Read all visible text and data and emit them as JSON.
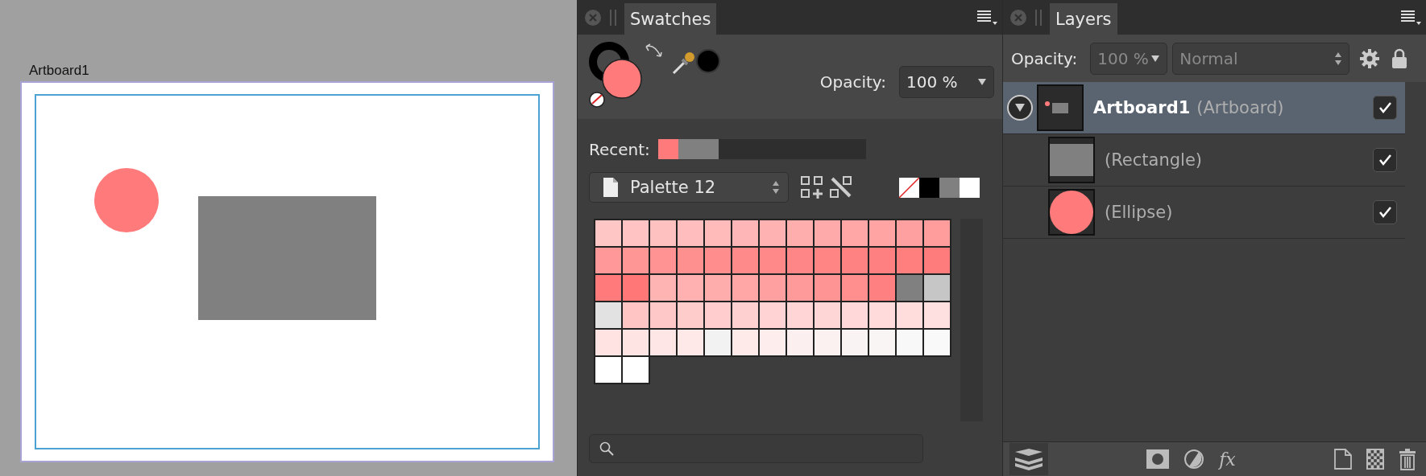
{
  "canvas": {
    "artboard_label": "Artboard1",
    "shapes": [
      {
        "kind": "ellipse",
        "color": "#ff7b7b"
      },
      {
        "kind": "rectangle",
        "color": "#808080"
      }
    ]
  },
  "swatches": {
    "tab": {
      "label": "Swatches",
      "selected": true
    },
    "fill": {
      "color": "#ff7b7b"
    },
    "stroke": {
      "color": "#000000"
    },
    "picked": {
      "color": "#000000"
    },
    "opacity": {
      "label": "Opacity:",
      "value": "100 %"
    },
    "recent": {
      "label": "Recent:",
      "colors": [
        {
          "color": "#ff7b7b"
        },
        {
          "color": "#808080"
        },
        {
          "color": "#808080"
        }
      ]
    },
    "palette": {
      "name": "Palette 12"
    },
    "quick": [
      {
        "kind": "none",
        "color": "#ffffff"
      },
      {
        "kind": "solid",
        "color": "#000000"
      },
      {
        "kind": "solid",
        "color": "#808080"
      },
      {
        "kind": "solid",
        "color": "#ffffff"
      }
    ],
    "grid": [
      {
        "color": "#ffc6c6"
      },
      {
        "color": "#ffc3c3"
      },
      {
        "color": "#ffc0c0"
      },
      {
        "color": "#ffbdbd"
      },
      {
        "color": "#ffbaba"
      },
      {
        "color": "#ffb6b6"
      },
      {
        "color": "#ffb2b2"
      },
      {
        "color": "#ffaeae"
      },
      {
        "color": "#ffaaaa"
      },
      {
        "color": "#ffa7a7"
      },
      {
        "color": "#ffa3a3"
      },
      {
        "color": "#ffa0a0"
      },
      {
        "color": "#ff9c9c"
      },
      {
        "color": "#ff9999"
      },
      {
        "color": "#ff9696"
      },
      {
        "color": "#ff9393"
      },
      {
        "color": "#ff9090"
      },
      {
        "color": "#ff8d8d"
      },
      {
        "color": "#ff8a8a"
      },
      {
        "color": "#ff8888"
      },
      {
        "color": "#ff8686"
      },
      {
        "color": "#ff8484"
      },
      {
        "color": "#ff8282"
      },
      {
        "color": "#ff8080"
      },
      {
        "color": "#ff7e7e"
      },
      {
        "color": "#ff7c7c"
      },
      {
        "color": "#ff7a7a"
      },
      {
        "color": "#ff7777"
      },
      {
        "color": "#ffb4b4"
      },
      {
        "color": "#ffb0b0"
      },
      {
        "color": "#ffacac"
      },
      {
        "color": "#ffa6a6"
      },
      {
        "color": "#ffa0a0"
      },
      {
        "color": "#ff9a9a"
      },
      {
        "color": "#ff9494"
      },
      {
        "color": "#ff8e8e"
      },
      {
        "color": "#ff8080"
      },
      {
        "color": "#808080"
      },
      {
        "color": "#c6c6c6"
      },
      {
        "color": "#e2e2e2"
      },
      {
        "color": "#ffc4c4"
      },
      {
        "color": "#ffc8c8"
      },
      {
        "color": "#ffcccc"
      },
      {
        "color": "#ffcdcd"
      },
      {
        "color": "#ffd0d0"
      },
      {
        "color": "#ffd3d3"
      },
      {
        "color": "#ffd5d5"
      },
      {
        "color": "#ffd6d6"
      },
      {
        "color": "#ffd9d9"
      },
      {
        "color": "#ffdbdb"
      },
      {
        "color": "#ffdddd"
      },
      {
        "color": "#ffe0e0"
      },
      {
        "color": "#ffe2e2"
      },
      {
        "color": "#ffe4e4"
      },
      {
        "color": "#ffe6e6"
      },
      {
        "color": "#ffe8e8"
      },
      {
        "color": "#f2f2f2"
      },
      {
        "color": "#ffeaea"
      },
      {
        "color": "#fdeded"
      },
      {
        "color": "#fcefef"
      },
      {
        "color": "#fbf1f1"
      },
      {
        "color": "#faf3f3"
      },
      {
        "color": "#f9f5f5"
      },
      {
        "color": "#f8f8f8"
      },
      {
        "color": "#f9f9f9"
      },
      {
        "color": "#ffffff"
      },
      {
        "color": "#ffffff"
      }
    ]
  },
  "layers": {
    "tab": {
      "label": "Layers",
      "selected": true
    },
    "opacity": {
      "label": "Opacity:",
      "value": "100 %",
      "disabled": true
    },
    "blend_mode": {
      "value": "Normal",
      "disabled": true
    },
    "items": [
      {
        "kind": "artboard",
        "name": "Artboard1",
        "type": "(Artboard)",
        "selected": true,
        "expanded": true,
        "visible": true,
        "children": [
          {
            "kind": "rectangle",
            "type": "(Rectangle)",
            "selected": false,
            "visible": true
          },
          {
            "kind": "ellipse",
            "type": "(Ellipse)",
            "selected": false,
            "visible": true
          }
        ]
      }
    ],
    "toolbar": {
      "fx_label": "fx"
    }
  }
}
